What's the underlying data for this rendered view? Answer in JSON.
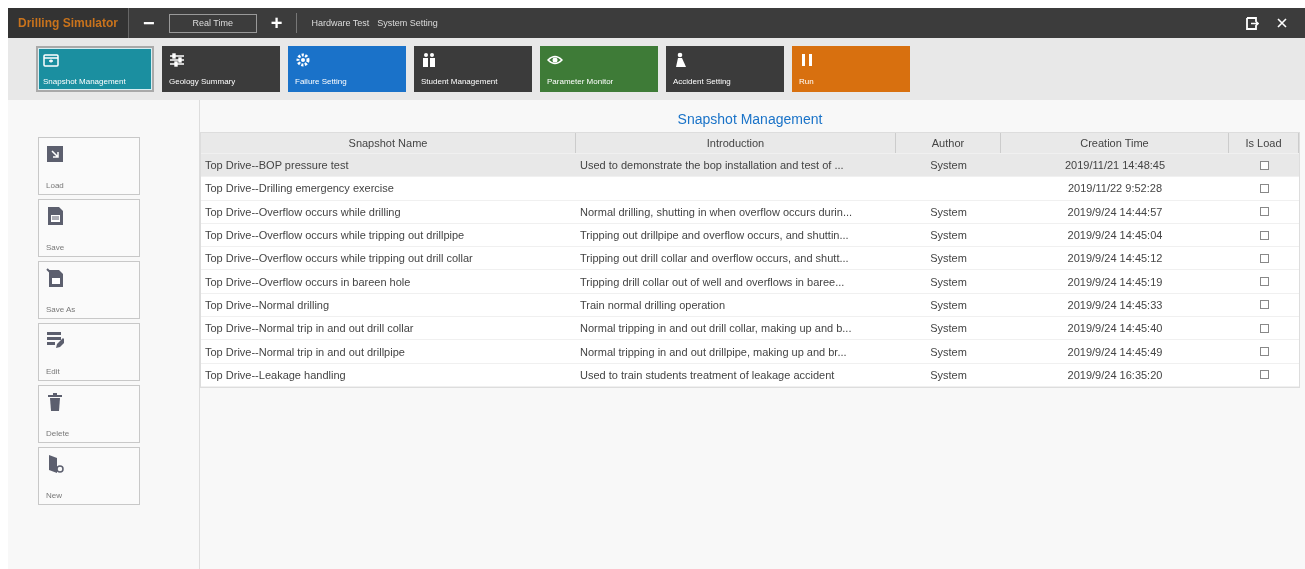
{
  "window": {
    "title": "Drilling Simulator"
  },
  "title_bar": {
    "minus": "−",
    "speed": "Real Time",
    "plus": "+",
    "menu": [
      "Hardware Test",
      "System Setting"
    ]
  },
  "modules": [
    {
      "label": "Snapshot Management",
      "kind": "folder",
      "color": "#1b8fa0",
      "selected": true
    },
    {
      "label": "Geology Summary",
      "kind": "sliders",
      "color": "#3b3b3b",
      "selected": false
    },
    {
      "label": "Failure Setting",
      "kind": "gear",
      "color": "#1a72c9",
      "selected": false
    },
    {
      "label": "Student Management",
      "kind": "people",
      "color": "#3b3b3b",
      "selected": false
    },
    {
      "label": "Parameter Monitor",
      "kind": "eye",
      "color": "#3e7b37",
      "selected": false
    },
    {
      "label": "Accident Setting",
      "kind": "person",
      "color": "#3b3b3b",
      "selected": false
    },
    {
      "label": "Run",
      "kind": "pause",
      "color": "#d8700f",
      "selected": false
    }
  ],
  "actions": [
    {
      "label": "Load",
      "kind": "load"
    },
    {
      "label": "Save",
      "kind": "save"
    },
    {
      "label": "Save As",
      "kind": "saveas"
    },
    {
      "label": "Edit",
      "kind": "edit"
    },
    {
      "label": "Delete",
      "kind": "delete"
    },
    {
      "label": "New",
      "kind": "new"
    }
  ],
  "panel_title": "Snapshot Management",
  "table": {
    "columns": [
      "Snapshot Name",
      "Introduction",
      "Author",
      "Creation Time",
      "Is Load"
    ],
    "rows": [
      {
        "name": "Top Drive--BOP pressure test",
        "intro": "Used to demonstrate the bop installation and test of ...",
        "author": "System",
        "time": "2019/11/21 14:48:45",
        "loaded": false,
        "selected": true
      },
      {
        "name": "Top Drive--Drilling emergency exercise",
        "time": "2019/11/22 9:52:28",
        "loaded": false,
        "selected": false
      },
      {
        "name": "Top Drive--Overflow occurs while drilling",
        "intro": "Normal drilling, shutting in when overflow occurs durin...",
        "author": "System",
        "time": "2019/9/24 14:44:57",
        "loaded": false,
        "selected": false
      },
      {
        "name": "Top Drive--Overflow occurs while tripping out drillpipe",
        "intro": "Tripping out drillpipe and overflow occurs, and shuttin...",
        "author": "System",
        "time": "2019/9/24 14:45:04",
        "loaded": false,
        "selected": false
      },
      {
        "name": "Top Drive--Overflow occurs while tripping out drill collar",
        "intro": "Tripping out drill collar and overflow occurs, and shutt...",
        "author": "System",
        "time": "2019/9/24 14:45:12",
        "loaded": false,
        "selected": false
      },
      {
        "name": "Top Drive--Overflow occurs in bareen hole",
        "intro": "Tripping drill collar out of well and overflows in baree...",
        "author": "System",
        "time": "2019/9/24 14:45:19",
        "loaded": false,
        "selected": false
      },
      {
        "name": "Top Drive--Normal drilling",
        "intro": "Train normal drilling operation",
        "author": "System",
        "time": "2019/9/24 14:45:33",
        "loaded": false,
        "selected": false
      },
      {
        "name": "Top Drive--Normal trip in and out drill collar",
        "intro": "Normal tripping in and out drill collar, making up and b...",
        "author": "System",
        "time": "2019/9/24 14:45:40",
        "loaded": false,
        "selected": false
      },
      {
        "name": "Top Drive--Normal trip in and out drillpipe",
        "intro": "Normal tripping in and out drillpipe, making up and br...",
        "author": "System",
        "time": "2019/9/24 14:45:49",
        "loaded": false,
        "selected": false
      },
      {
        "name": "Top Drive--Leakage handling",
        "intro": "Used to train students treatment of leakage accident",
        "author": "System",
        "time": "2019/9/24 16:35:20",
        "loaded": false,
        "selected": false
      }
    ]
  }
}
